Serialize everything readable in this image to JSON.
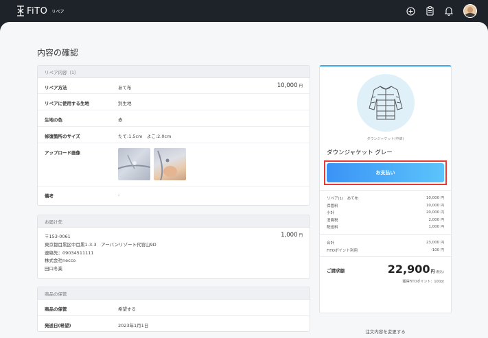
{
  "app": {
    "logo": "FiTO",
    "section": "リペア"
  },
  "page": {
    "title": "内容の確認"
  },
  "repair": {
    "header": "リペア内容（1）",
    "method_label": "リペア方法",
    "method_value": "あて布",
    "method_price": "10,000",
    "yen": "円",
    "fabric_label": "リペアに使用する生地",
    "fabric_value": "別生地",
    "color_label": "生地の色",
    "color_value": "赤",
    "size_label": "修復箇所のサイズ",
    "size_value": "たて:1.5cm　よこ:2.0cm",
    "upload_label": "アップロード画像",
    "notes_label": "備考",
    "notes_value": "-"
  },
  "delivery": {
    "header": "お届け先",
    "postal": "〒153-0061",
    "address": "東京都目黒区中目黒1-3-3　アーバンリゾート代官山9D",
    "phone": "連絡先：09034511111",
    "company": "株式会社necco",
    "name": "田口冬業",
    "price": "1,000"
  },
  "storage": {
    "header": "商品の保管",
    "storage_label": "商品の保管",
    "storage_value": "希望する",
    "date_label": "発送日(希望)",
    "date_value": "2023年1月1日"
  },
  "summary": {
    "product_caption": "ダウンジャケット(中綿)",
    "product_name": "ダウンジャケット グレー",
    "pay_button": "お支払い",
    "fees": [
      {
        "label": "リペア(1)　あて布",
        "amount": "10,000"
      },
      {
        "label": "保管料",
        "amount": "10,000"
      },
      {
        "label": "小計",
        "amount": "20,000"
      },
      {
        "label": "消費税",
        "amount": "2,000"
      },
      {
        "label": "配送料",
        "amount": "1,000"
      }
    ],
    "totals": [
      {
        "label": "合計",
        "amount": "23,000"
      },
      {
        "label": "FiTOポイント利用",
        "amount": "-100"
      }
    ],
    "yen": "円",
    "billing_label": "ご請求額",
    "billing_amount": "22,900",
    "billing_yen": "円",
    "tax_note": "(税込)",
    "points_note": "獲得FiTOポイント：100pt"
  },
  "change_link": "注文内容を変更する",
  "colors": {
    "accent": "#3a93f5",
    "highlight": "#e53935",
    "topbar": "#1e2229"
  }
}
